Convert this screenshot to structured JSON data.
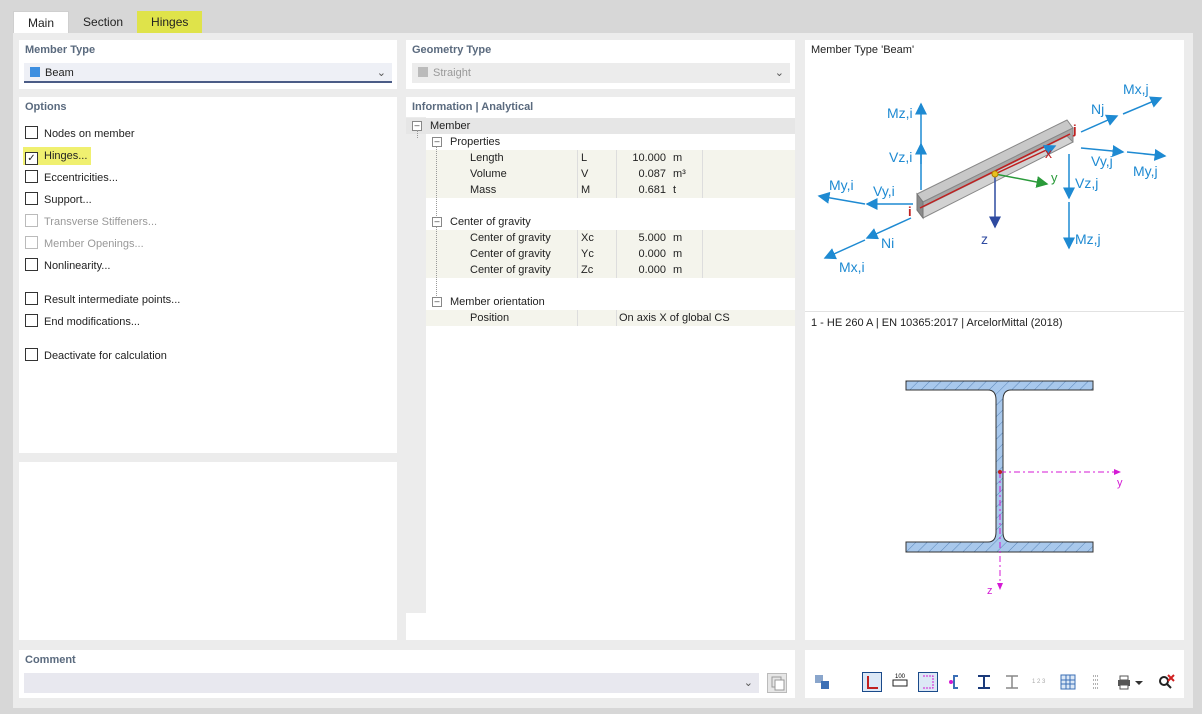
{
  "tabs": [
    "Main",
    "Section",
    "Hinges"
  ],
  "member_type": {
    "title": "Member Type",
    "value": "Beam",
    "color": "#3d8fe0"
  },
  "geometry_type": {
    "title": "Geometry Type",
    "value": "Straight"
  },
  "options": {
    "title": "Options",
    "items": [
      {
        "label": "Nodes on member",
        "checked": false,
        "enabled": true
      },
      {
        "label": "Hinges...",
        "checked": true,
        "enabled": true
      },
      {
        "label": "Eccentricities...",
        "checked": false,
        "enabled": true
      },
      {
        "label": "Support...",
        "checked": false,
        "enabled": true
      },
      {
        "label": "Transverse Stiffeners...",
        "checked": false,
        "enabled": false
      },
      {
        "label": "Member Openings...",
        "checked": false,
        "enabled": false
      },
      {
        "label": "Nonlinearity...",
        "checked": false,
        "enabled": true
      },
      {
        "label": "Result intermediate points...",
        "checked": false,
        "enabled": true
      },
      {
        "label": "End modifications...",
        "checked": false,
        "enabled": true
      },
      {
        "label": "Deactivate for calculation",
        "checked": false,
        "enabled": true
      }
    ]
  },
  "info": {
    "title": "Information | Analytical",
    "root": "Member",
    "groups": [
      {
        "label": "Properties",
        "rows": [
          {
            "name": "Length",
            "sym": "L",
            "value": "10.000",
            "unit": "m"
          },
          {
            "name": "Volume",
            "sym": "V",
            "value": "0.087",
            "unit": "m³"
          },
          {
            "name": "Mass",
            "sym": "M",
            "value": "0.681",
            "unit": "t"
          }
        ]
      },
      {
        "label": "Center of gravity",
        "rows": [
          {
            "name": "Center of gravity",
            "sym": "Xc",
            "value": "5.000",
            "unit": "m"
          },
          {
            "name": "Center of gravity",
            "sym": "Yc",
            "value": "0.000",
            "unit": "m"
          },
          {
            "name": "Center of gravity",
            "sym": "Zc",
            "value": "0.000",
            "unit": "m"
          }
        ]
      },
      {
        "label": "Member orientation",
        "rows": [
          {
            "name": "Position",
            "sym": "",
            "value": "On axis X of global CS",
            "unit": ""
          }
        ]
      }
    ]
  },
  "preview": {
    "title": "Member Type 'Beam'",
    "section_label": "1 - HE 260 A | EN 10365:2017 | ArcelorMittal (2018)",
    "diagram_labels": {
      "mzi": "Mz,i",
      "vzi": "Vz,i",
      "myi": "My,i",
      "vyi": "Vy,i",
      "i": "i",
      "ni": "Ni",
      "mxi": "Mx,i",
      "j": "j",
      "nj": "Nj",
      "mxj": "Mx,j",
      "vyj": "Vy,j",
      "myj": "My,j",
      "vzj": "Vz,j",
      "mzj": "Mz,j",
      "x": "x",
      "y": "y",
      "z": "z"
    },
    "section_axes": {
      "y": "y",
      "z": "z"
    }
  },
  "comment": {
    "title": "Comment",
    "value": ""
  },
  "toolbar_icons": [
    "info-swap-icon",
    "section-outline-icon",
    "dimensions-icon",
    "axes-icon",
    "centroid-icon",
    "i-section-icon",
    "i-section-outline-icon",
    "numbering-icon",
    "grid-icon",
    "list-icon",
    "print-icon",
    "print-dropdown-icon",
    "close-search-icon"
  ],
  "colors": {
    "accent": "#1e8ad2",
    "highlight": "#dfe34a",
    "section_fill": "#a8c8ec",
    "axis": "#d41ad4"
  }
}
